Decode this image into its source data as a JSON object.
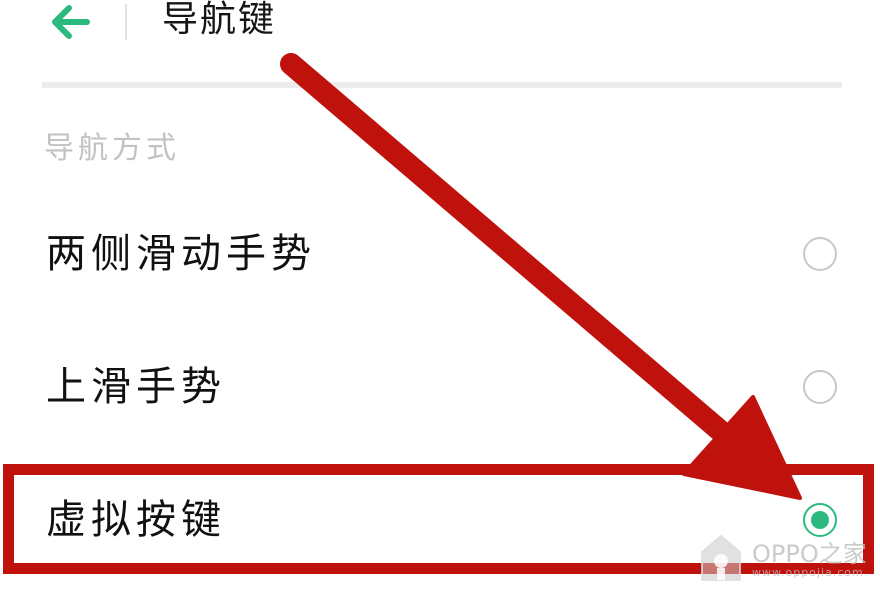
{
  "header": {
    "back_icon": "arrow-left-icon",
    "title": "导航键"
  },
  "section": {
    "title": "导航方式"
  },
  "options": [
    {
      "label": "两侧滑动手势",
      "selected": false
    },
    {
      "label": "上滑手势",
      "selected": false
    },
    {
      "label": "虚拟按键",
      "selected": true
    }
  ],
  "watermark": {
    "logo_icon": "oppo-home-logo-icon",
    "brand": "OPPO之家",
    "url": "www.oppojia.com"
  },
  "colors": {
    "accent": "#2bb97e",
    "annotation": "#c0120d",
    "radio_border": "#c8c8c8",
    "section_text": "#c2c2c2"
  }
}
